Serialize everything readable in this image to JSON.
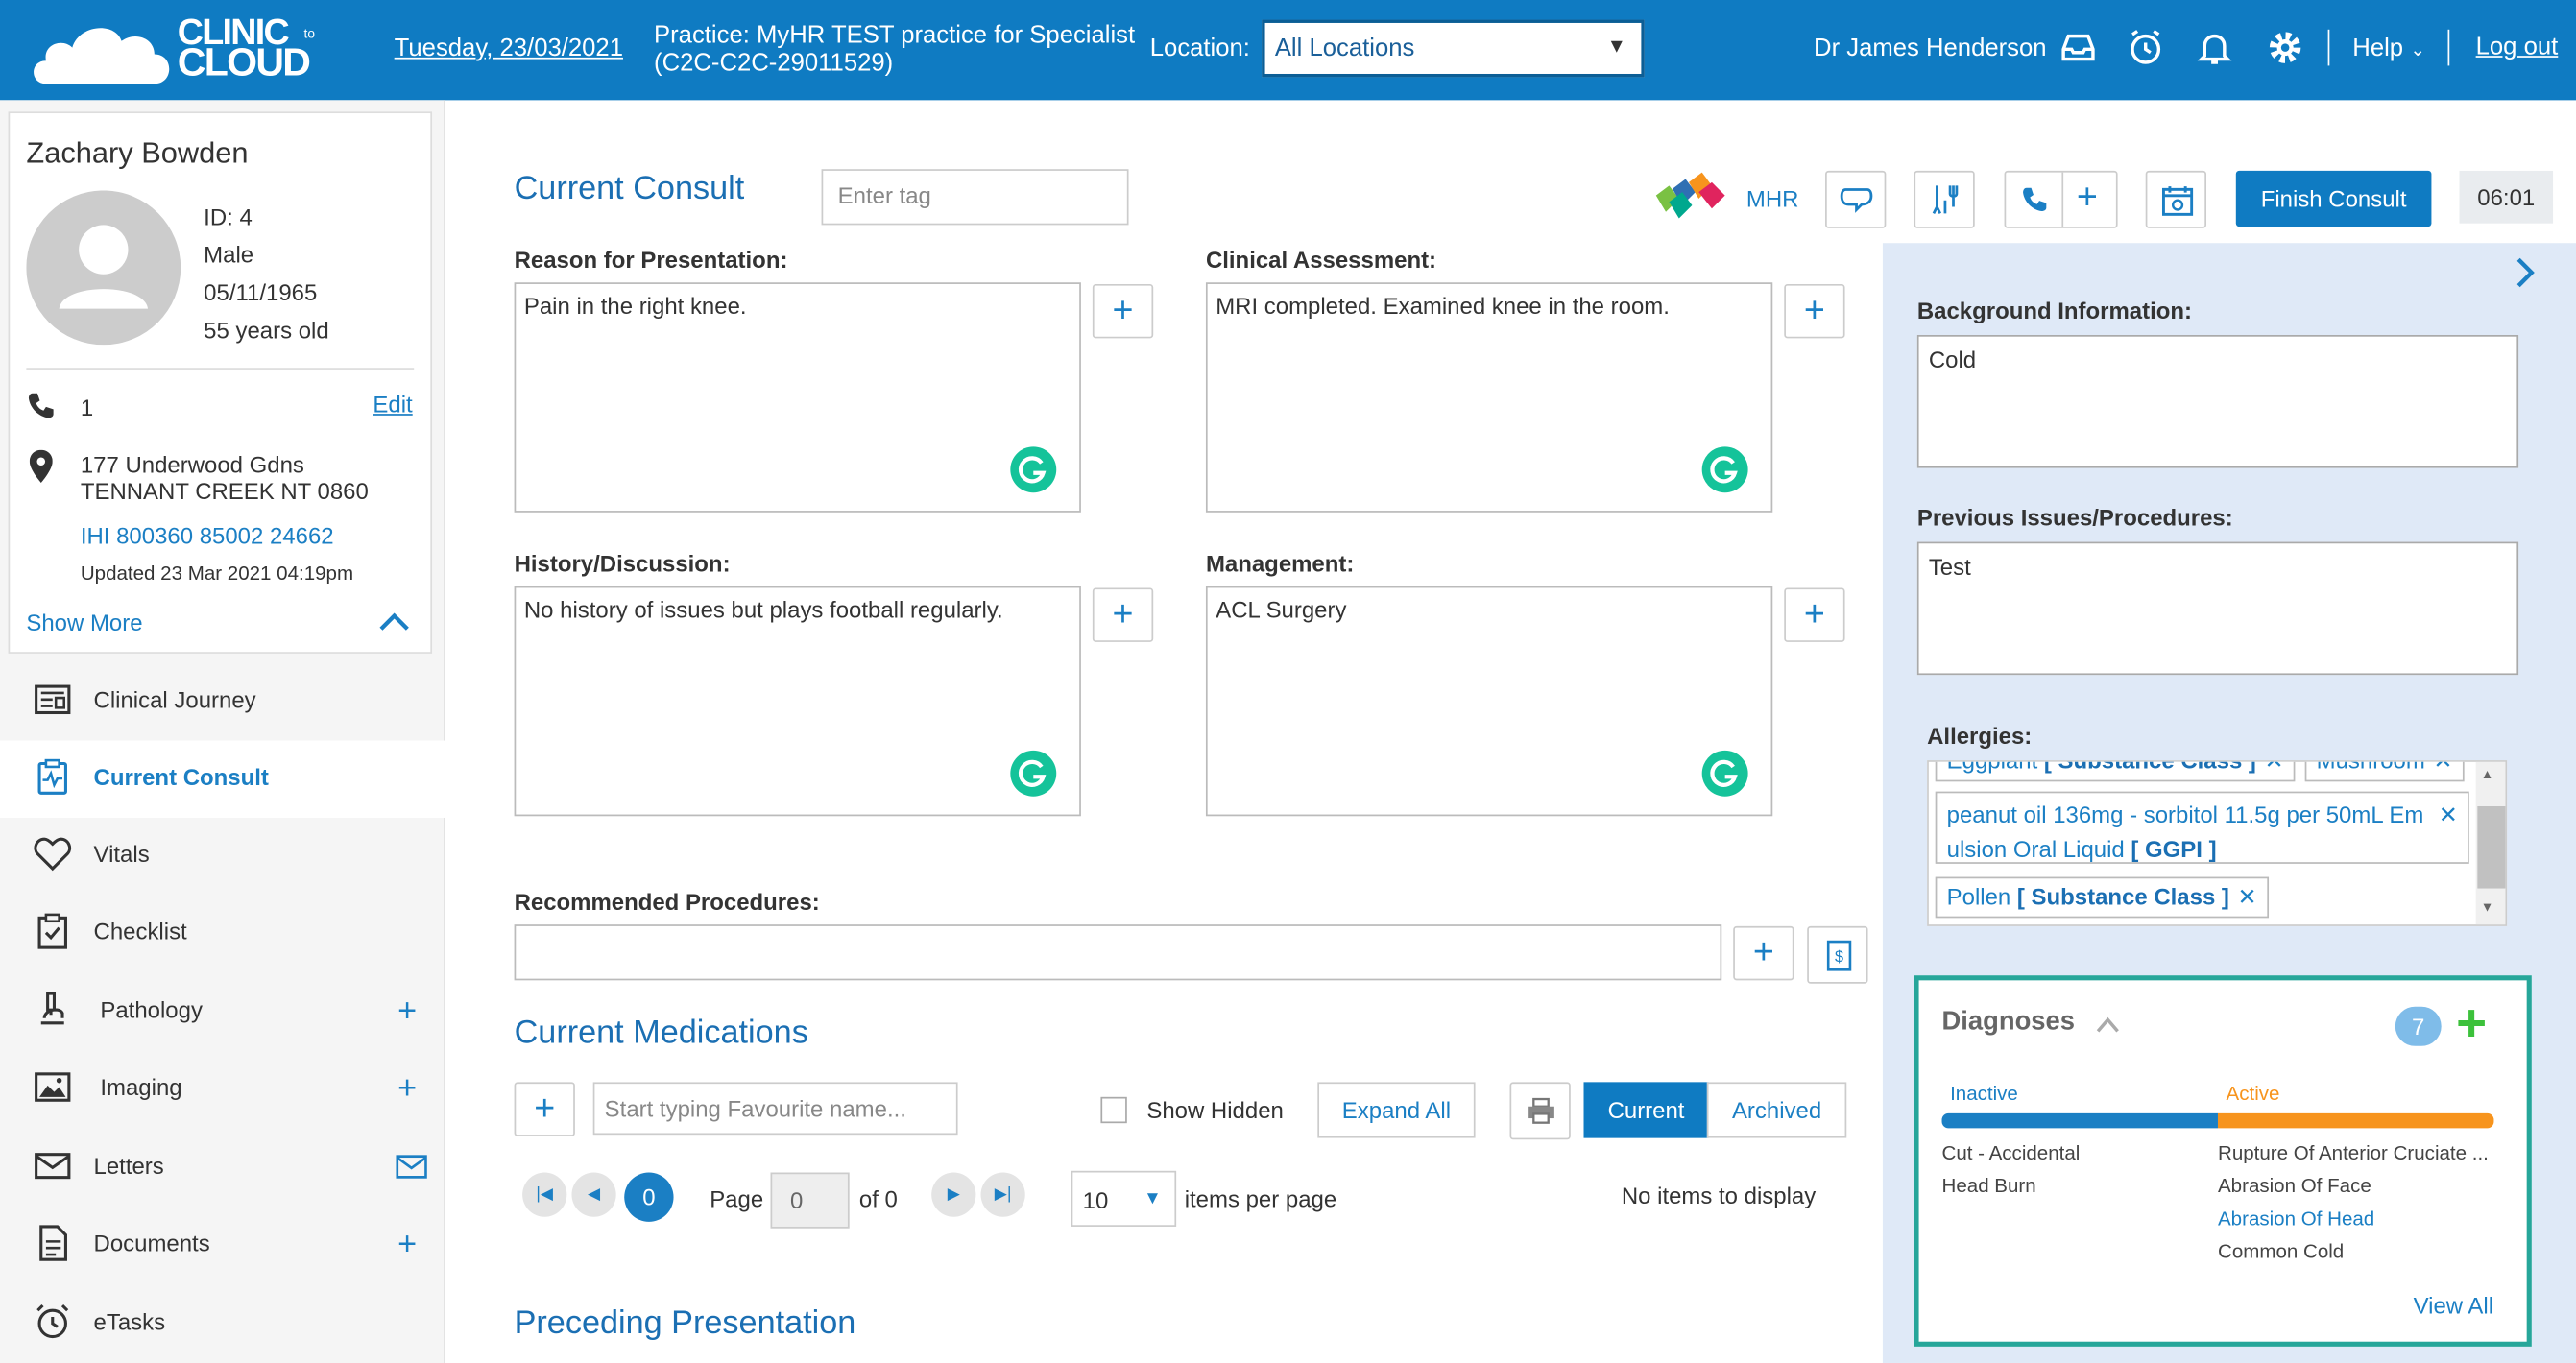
{
  "header": {
    "logo_line1": "CLINIC",
    "logo_to": "to",
    "logo_line2": "CLOUD",
    "date": "Tuesday, 23/03/2021",
    "practice_line1": "Practice: MyHR TEST practice for Specialist",
    "practice_line2": "(C2C-C2C-29011529)",
    "location_label": "Location:",
    "location_value": "All Locations",
    "doctor": "Dr James Henderson",
    "help": "Help",
    "logout": "Log out"
  },
  "patient": {
    "name": "Zachary Bowden",
    "id": "ID: 4",
    "sex": "Male",
    "dob": "05/11/1965",
    "age": "55 years old",
    "phone": "1",
    "edit": "Edit",
    "address_line1": "177 Underwood Gdns",
    "address_line2": "TENNANT CREEK NT 0860",
    "ihi": "IHI 800360 85002 24662",
    "updated": "Updated 23 Mar 2021 04:19pm",
    "show_more": "Show More"
  },
  "nav": {
    "items": [
      {
        "label": "Clinical Journey"
      },
      {
        "label": "Current Consult"
      },
      {
        "label": "Vitals"
      },
      {
        "label": "Checklist"
      },
      {
        "label": "Pathology"
      },
      {
        "label": "Imaging"
      },
      {
        "label": "Letters"
      },
      {
        "label": "Documents"
      },
      {
        "label": "eTasks"
      }
    ]
  },
  "consult": {
    "title": "Current Consult",
    "tag_placeholder": "Enter tag",
    "mhr": "MHR",
    "finish": "Finish Consult",
    "timer": "06:01",
    "reason_label": "Reason for Presentation:",
    "reason_value": "Pain in the right knee.",
    "assessment_label": "Clinical Assessment:",
    "assessment_value": "MRI completed. Examined knee in the room.",
    "history_label": "History/Discussion:",
    "history_value": "No history of issues but plays football regularly.",
    "management_label": "Management:",
    "management_value": "ACL Surgery",
    "recommended_label": "Recommended Procedures:"
  },
  "medications": {
    "title": "Current Medications",
    "search_placeholder": "Start typing Favourite name...",
    "show_hidden": "Show Hidden",
    "expand_all": "Expand All",
    "current": "Current",
    "archived": "Archived",
    "page_current": "0",
    "page_label": "Page",
    "page_input": "0",
    "of": "of 0",
    "per_page": "10",
    "per_page_label": "items per page",
    "no_items": "No items to display"
  },
  "preceding": {
    "title": "Preceding Presentation"
  },
  "right": {
    "background_label": "Background Information:",
    "background_value": "Cold",
    "previous_label": "Previous Issues/Procedures:",
    "previous_value": "Test",
    "allergies_label": "Allergies:",
    "allergy_top_left": "Eggplant",
    "allergy_top_left_class": "[ Substance Class ]",
    "allergy_top_right": "Mushroom",
    "allergy_mid_name_1": "peanut oil 136mg - sorbitol 11.5g per 50mL Em",
    "allergy_mid_name_2": "ulsion Oral Liquid",
    "allergy_mid_class": "[ GGPI ]",
    "allergy_bot_name": "Pollen",
    "allergy_bot_class": "[ Substance Class ]"
  },
  "diagnoses": {
    "title": "Diagnoses",
    "count": "7",
    "inactive_label": "Inactive",
    "active_label": "Active",
    "inactive": [
      "Cut - Accidental",
      "Head Burn"
    ],
    "active": [
      "Rupture Of Anterior Cruciate ...",
      "Abrasion Of Face",
      "Abrasion Of Head",
      "Common Cold"
    ],
    "view_all": "View All",
    "colors": {
      "inactive": "#1b7fc4",
      "active": "#f7941d",
      "accent": "#26a69a"
    }
  }
}
